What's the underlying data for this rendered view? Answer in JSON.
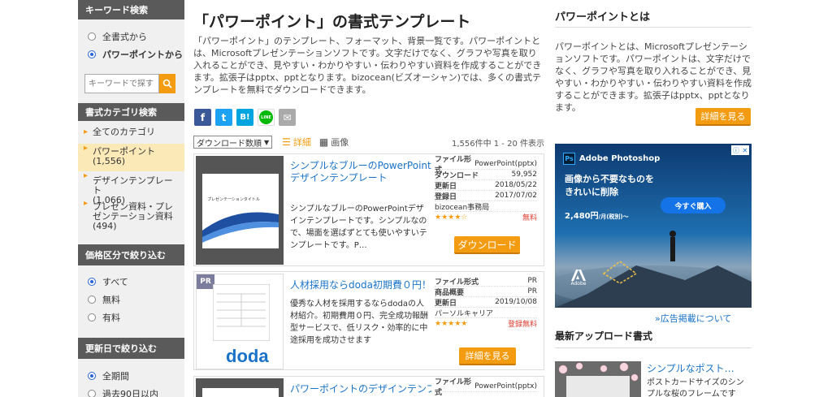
{
  "sidebar": {
    "keyword_heading": "キーワード検索",
    "scope_all": "全書式から",
    "scope_pp": "パワーポイントから",
    "search_placeholder": "キーワードで探す",
    "category_heading": "書式カテゴリ検索",
    "categories": [
      {
        "label": "全てのカテゴリ"
      },
      {
        "label": "パワーポイント",
        "count": "(1,556)"
      },
      {
        "label": "デザインテンプレート",
        "count": "(1,066)"
      },
      {
        "label": "プレゼン資料・プレゼンテーション資料",
        "count": "(494)"
      }
    ],
    "price_heading": "価格区分で絞り込む",
    "price_options": [
      "すべて",
      "無料",
      "有料"
    ],
    "date_heading": "更新日で絞り込む",
    "date_options": [
      "全期間",
      "過去90日以内"
    ]
  },
  "main": {
    "title": "「パワーポイント」の書式テンプレート",
    "intro": "「パワーポイント」のテンプレート、フォーマット、背景一覧です。パワーポイントとは、Microsoftプレゼンテーションソフトです。文字だけでなく、グラフや写真を取り入れることができ、見やすい・わかりやすい・伝わりやすい資料を作成することができます。拡張子はpptx、pptとなります。bizocean(ビズオーシャン)では、多くの書式テンプレートを無料でダウンロードできます。",
    "share": {
      "facebook": "f",
      "twitter": "t",
      "hatena": "B!",
      "line": "LINE",
      "mail": "✉"
    },
    "sort_label": "ダウンロード数順",
    "view_detail": "詳細",
    "view_grid": "画像",
    "result_count": "1,556件中 1 - 20 件表示",
    "items": [
      {
        "title": "シンプルなブルーのPowerPointデザインテンプレート",
        "desc": "シンプルなブルーのPowerPointデザインテンプレートです。シンプルなので、場面を選ばずとても使いやすいテンプレートです。P…",
        "thumb_caption": "プレゼンテーションタイトル",
        "meta": [
          {
            "k": "ファイル形式",
            "v": "PowerPoint(pptx)"
          },
          {
            "k": "ダウンロード",
            "v": "59,952"
          },
          {
            "k": "更新日",
            "v": "2018/05/22"
          },
          {
            "k": "登録日",
            "v": "2017/07/02"
          }
        ],
        "author": "bizocean事務局",
        "stars": "★★★★☆",
        "price": "無料",
        "button": "ダウンロード"
      },
      {
        "pr": "PR",
        "title": "人材採用ならdoda初期費０円！",
        "desc": "優秀な人材を採用するならdodaの人材紹介。初期費用０円、完全成功報酬型サービスで、低リスク・効率的に中途採用を成功させます",
        "logo": "doda",
        "meta": [
          {
            "k": "ファイル形式",
            "v": "PR"
          },
          {
            "k": "商品概要",
            "v": "PR"
          },
          {
            "k": "更新日",
            "v": "2019/10/08"
          }
        ],
        "author": "パーソルキャリア",
        "stars": "★★★★★",
        "price": "登録無料",
        "button": "詳細を見る"
      },
      {
        "title": "パワーポイントのデザインテンプレート",
        "meta": [
          {
            "k": "ファイル形式",
            "v": "PowerPoint(pptx)"
          }
        ]
      }
    ]
  },
  "right": {
    "about_title": "パワーポイントとは",
    "about_text": "パワーポイントとは、Microsoftプレゼンテーションソフトです。パワーポイントは、文字だけでなく、グラフや写真を取り入れることができ、見やすい・わかりやすい・伝わりやすい資料を作成することができます。拡張子はpptx、pptとなります。",
    "about_button": "詳細を見る",
    "ad": {
      "brand": "Adobe Photoshop",
      "headline1": "画像から不要なものを",
      "headline2": "きれいに削除",
      "cta": "今すぐ購入",
      "price_main": "2,480円",
      "price_sub": "/月(税別)～",
      "logo_text": "Adobe",
      "ps_badge": "Ps"
    },
    "ad_link": "»広告掲載について",
    "latest_title": "最新アップロード書式",
    "latest_item": {
      "title": "シンプルなポスト…",
      "desc": "ポストカードサイズのシンプルな桜のフレームです"
    }
  },
  "colors": {
    "accent": "#f39c12",
    "link": "#1a73c8",
    "sidebar_head": "#5a5a5a"
  }
}
